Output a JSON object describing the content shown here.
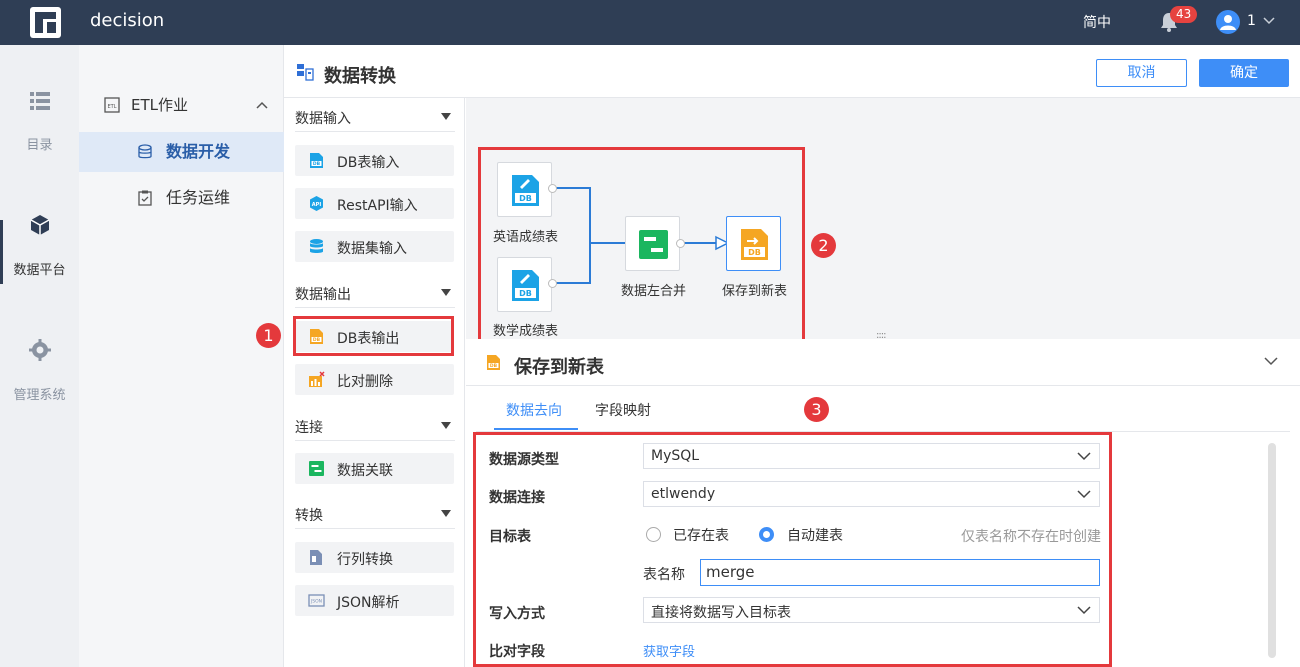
{
  "topbar": {
    "app_name": "decision",
    "lang": "简中",
    "notif_count": "43",
    "user": "1"
  },
  "leftnav": {
    "items": [
      {
        "label": "目录",
        "icon": "list-icon"
      },
      {
        "label": "数据平台",
        "icon": "cube-icon"
      },
      {
        "label": "管理系统",
        "icon": "gear-icon"
      }
    ]
  },
  "subnav": {
    "group": "ETL作业",
    "items": [
      {
        "label": "数据开发",
        "icon": "database-icon",
        "active": true
      },
      {
        "label": "任务运维",
        "icon": "clipboard-icon",
        "active": false
      }
    ]
  },
  "header": {
    "title": "数据转换",
    "cancel": "取消",
    "ok": "确定"
  },
  "palette": {
    "sections": [
      {
        "title": "数据输入",
        "items": [
          "DB表输入",
          "RestAPI输入",
          "数据集输入"
        ]
      },
      {
        "title": "数据输出",
        "items": [
          "DB表输出",
          "比对删除"
        ]
      },
      {
        "title": "连接",
        "items": [
          "数据关联"
        ]
      },
      {
        "title": "转换",
        "items": [
          "行列转换",
          "JSON解析"
        ]
      }
    ]
  },
  "canvas": {
    "nodes": [
      {
        "label": "英语成绩表",
        "badge": "DB"
      },
      {
        "label": "数学成绩表",
        "badge": "DB"
      },
      {
        "label": "数据左合并",
        "badge": ""
      },
      {
        "label": "保存到新表",
        "badge": "DB"
      }
    ]
  },
  "annotations": {
    "n1": "1",
    "n2": "2",
    "n3": "3"
  },
  "panel": {
    "title": "保存到新表",
    "tabs": [
      "数据去向",
      "字段映射"
    ],
    "form": {
      "source_type_label": "数据源类型",
      "source_type_value": "MySQL",
      "connection_label": "数据连接",
      "connection_value": "etlwendy",
      "target_label": "目标表",
      "radio_existing": "已存在表",
      "radio_auto": "自动建表",
      "hint": "仅表名称不存在时创建",
      "table_name_label": "表名称",
      "table_name_value": "merge",
      "write_label": "写入方式",
      "write_value": "直接将数据写入目标表",
      "compare_label": "比对字段",
      "compare_link": "获取字段"
    }
  },
  "colors": {
    "accent": "#3e8ef7",
    "topbar": "#2f3e55",
    "annotation_red": "#e4393c",
    "node_blue": "#1ca3e6",
    "node_green": "#1bb65f",
    "node_orange": "#f5a623"
  }
}
